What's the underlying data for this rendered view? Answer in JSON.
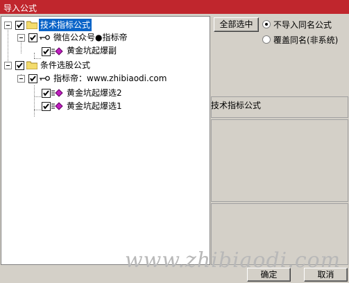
{
  "window": {
    "title": "导入公式"
  },
  "tree": {
    "nodes": [
      {
        "label": "技术指标公式",
        "level": 0,
        "checked": true,
        "selected": true,
        "icon": "folder-icon"
      },
      {
        "label": "微信公众号●指标帝",
        "level": 1,
        "checked": true,
        "icon": "key-icon"
      },
      {
        "label": "黄金坑起爆副",
        "level": 2,
        "checked": true,
        "icon": "formula-icon"
      },
      {
        "label": "条件选股公式",
        "level": 0,
        "checked": true,
        "icon": "folder-icon"
      },
      {
        "label": "指标帝：www.zhibiaodi.com",
        "level": 1,
        "checked": true,
        "icon": "key-icon"
      },
      {
        "label": "黄金坑起爆选2",
        "level": 2,
        "checked": true,
        "icon": "formula-icon"
      },
      {
        "label": "黄金坑起爆选1",
        "level": 2,
        "checked": true,
        "icon": "formula-icon"
      }
    ]
  },
  "options": {
    "select_all_label": "全部选中",
    "radio_skip_label": "不导入同名公式",
    "radio_overwrite_label": "覆盖同名(非系统)",
    "selected_option": "不导入同名公式"
  },
  "info_panel": {
    "title": "技术指标公式"
  },
  "watermark": "www.zhibiaodi.com",
  "buttons": {
    "ok_label": "确定",
    "cancel_label": "取消"
  },
  "colors": {
    "title_bar": "#c0262d",
    "selection": "#0a64c8",
    "formula_icon": "#c020c0"
  }
}
